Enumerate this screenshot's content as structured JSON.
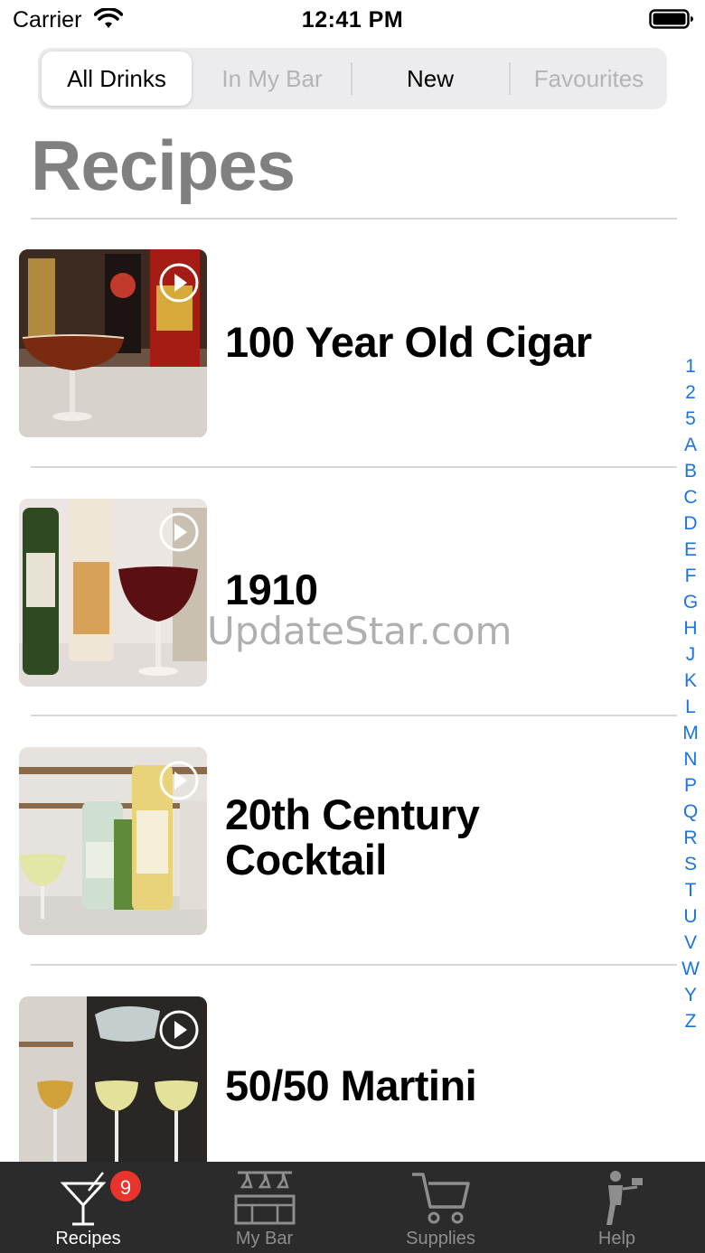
{
  "status_bar": {
    "carrier": "Carrier",
    "time": "12:41 PM"
  },
  "segments": [
    "All Drinks",
    "In My Bar",
    "New",
    "Favourites"
  ],
  "page_title": "Recipes",
  "recipes": [
    {
      "name": "100 Year Old Cigar"
    },
    {
      "name": "1910"
    },
    {
      "name": "20th Century Cocktail",
      "line1": "20th Century",
      "line2": "Cocktail"
    },
    {
      "name": "50/50 Martini"
    }
  ],
  "watermark": "UpdateStar.com",
  "index_letters": [
    "1",
    "2",
    "5",
    "A",
    "B",
    "C",
    "D",
    "E",
    "F",
    "G",
    "H",
    "J",
    "K",
    "L",
    "M",
    "N",
    "P",
    "Q",
    "R",
    "S",
    "T",
    "U",
    "V",
    "W",
    "Y",
    "Z"
  ],
  "tabs": [
    {
      "label": "Recipes",
      "icon": "cocktail-glass-icon",
      "badge": "9"
    },
    {
      "label": "My Bar",
      "icon": "bar-counter-icon"
    },
    {
      "label": "Supplies",
      "icon": "shopping-cart-icon"
    },
    {
      "label": "Help",
      "icon": "waiter-icon"
    }
  ],
  "colors": {
    "accent": "#1a74e8",
    "tab_bar": "#2b2b2b",
    "badge": "#e8342d",
    "title": "#808080"
  }
}
